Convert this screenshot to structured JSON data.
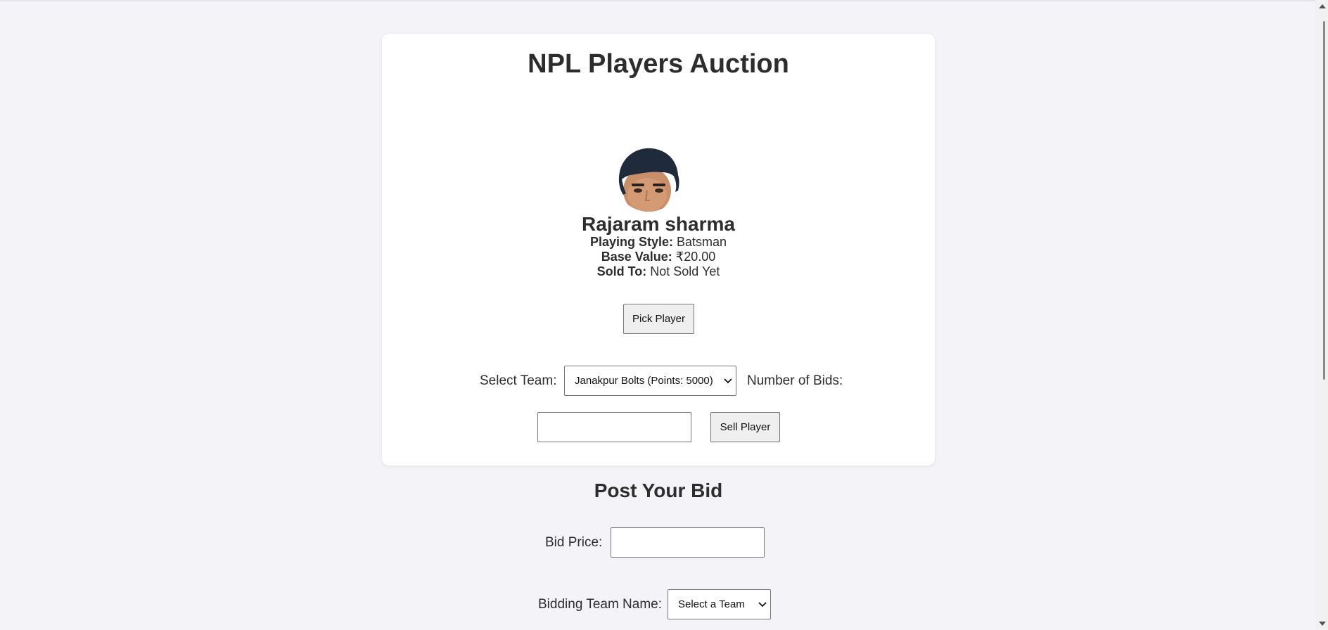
{
  "app": {
    "title": "NPL Players Auction"
  },
  "player": {
    "name": "Rajaram sharma",
    "playing_style_label": "Playing Style:",
    "playing_style": "Batsman",
    "base_value_label": "Base Value:",
    "base_value": "₹20.00",
    "sold_to_label": "Sold To:",
    "sold_to": "Not Sold Yet",
    "photo_icon": "player-photo"
  },
  "actions": {
    "pick_player": "Pick Player",
    "sell_player": "Sell Player"
  },
  "sell_form": {
    "select_team_label": "Select Team:",
    "selected_team": "Janakpur Bolts (Points: 5000)",
    "number_of_bids_label": "Number of Bids:",
    "number_of_bids_value": ""
  },
  "bid_section": {
    "title": "Post Your Bid",
    "bid_price_label": "Bid Price:",
    "bid_price_value": "",
    "bidding_team_label": "Bidding Team Name:",
    "bidding_team_selected": "Select a Team"
  },
  "colors": {
    "background": "#f3f3f8",
    "card": "#ffffff",
    "text": "#2d2d2d"
  }
}
